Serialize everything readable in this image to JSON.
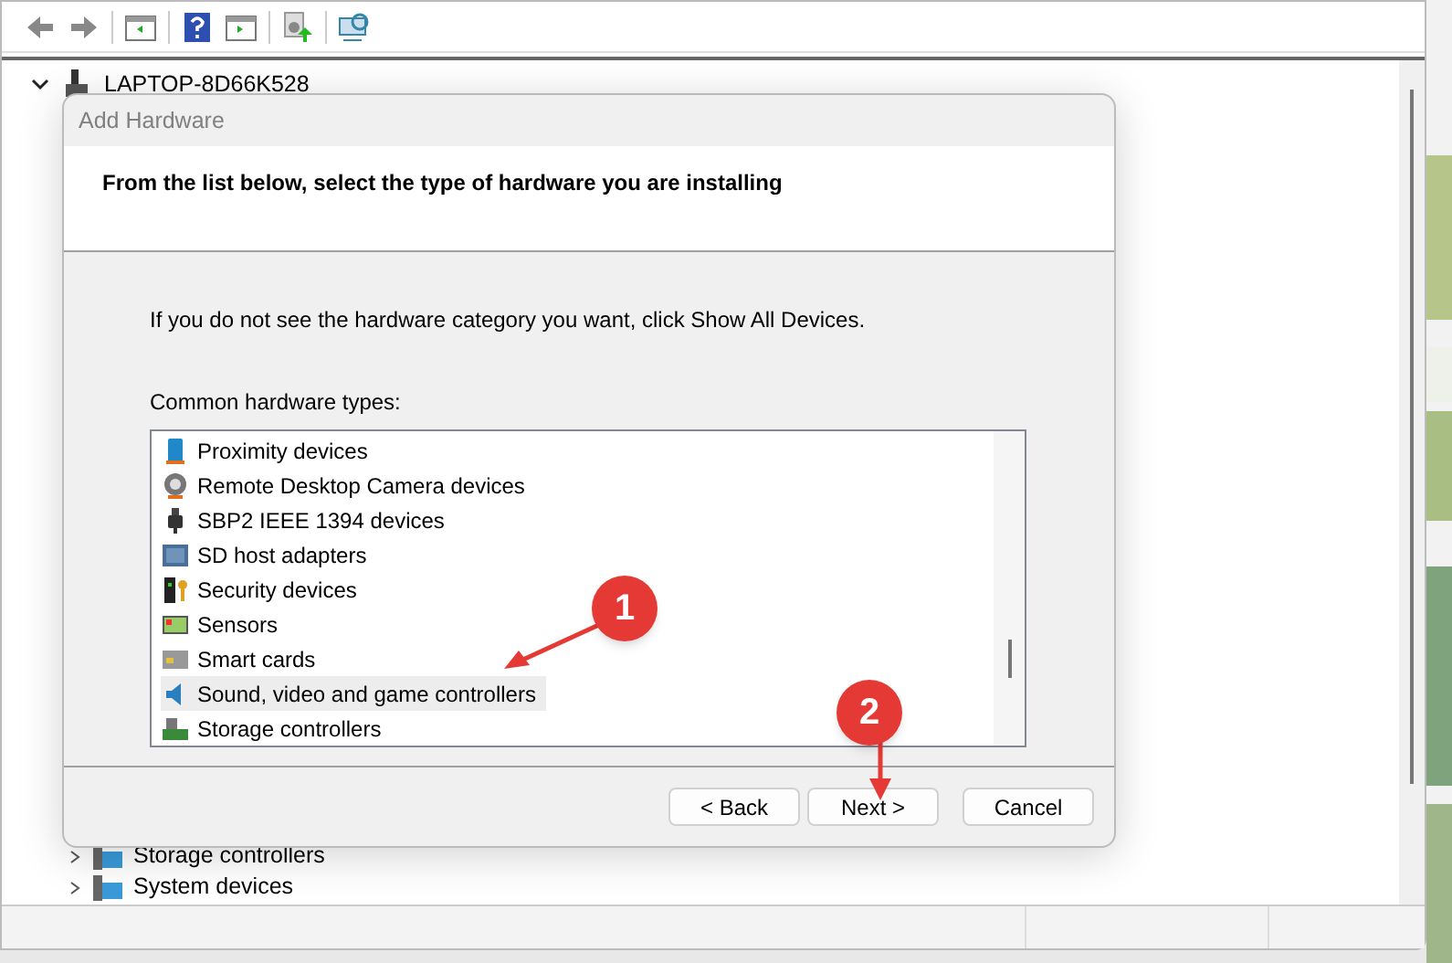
{
  "tree": {
    "root": {
      "label": "LAPTOP-8D66K528",
      "expanded": true
    },
    "children": [
      {
        "label": "Storage controllers"
      },
      {
        "label": "System devices"
      }
    ]
  },
  "dialog": {
    "title": "Add Hardware",
    "heading": "From the list below, select the type of hardware you are installing",
    "hint": "If you do not see the hardware category you want, click Show All Devices.",
    "list_label": "Common hardware types:",
    "items": [
      {
        "label": "Proximity devices",
        "kind": "proximity",
        "selected": false
      },
      {
        "label": "Remote Desktop Camera devices",
        "kind": "camera",
        "selected": false
      },
      {
        "label": "SBP2 IEEE 1394 devices",
        "kind": "plug",
        "selected": false
      },
      {
        "label": "SD host adapters",
        "kind": "sd",
        "selected": false
      },
      {
        "label": "Security devices",
        "kind": "security",
        "selected": false
      },
      {
        "label": "Sensors",
        "kind": "sensor",
        "selected": false
      },
      {
        "label": "Smart cards",
        "kind": "card",
        "selected": false
      },
      {
        "label": "Sound, video and game controllers",
        "kind": "sound",
        "selected": true
      },
      {
        "label": "Storage controllers",
        "kind": "storage",
        "selected": false
      }
    ],
    "buttons": [
      {
        "label": "< Back"
      },
      {
        "label": "Next >"
      },
      {
        "label": "Cancel"
      }
    ]
  },
  "annotations": [
    {
      "label": "1"
    },
    {
      "label": "2"
    }
  ]
}
